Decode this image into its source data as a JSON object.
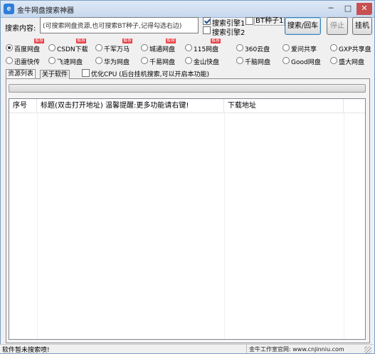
{
  "window": {
    "title": "金牛网盘搜索神器",
    "controls": {
      "minimize": "─",
      "maximize": "□",
      "close": "✕"
    }
  },
  "search": {
    "label": "搜索内容:",
    "value": "(可搜索网盘资源,也可搜索BT种子,记得勾选右边)",
    "engine1_label": "搜索引擎1",
    "engine1_checked": true,
    "engine2_label": "搜索引擎2",
    "engine2_checked": false,
    "bt_label": "BT种子1",
    "bt_checked": false,
    "search_button": "搜索/回车",
    "stop_button": "停止",
    "hang_button": "挂机"
  },
  "disks_row1": [
    {
      "label": "百度网盘",
      "selected": true,
      "badge": "推荐"
    },
    {
      "label": "CSDN下载",
      "selected": false,
      "badge": "推荐"
    },
    {
      "label": "千军万马",
      "selected": false,
      "badge": "推荐"
    },
    {
      "label": "城通网盘",
      "selected": false,
      "badge": "推荐"
    },
    {
      "label": "115网盘",
      "selected": false,
      "badge": "推荐"
    },
    {
      "label": "360云盘",
      "selected": false,
      "badge": ""
    },
    {
      "label": "爱问共享",
      "selected": false,
      "badge": ""
    },
    {
      "label": "GXP共享盘",
      "selected": false,
      "badge": ""
    }
  ],
  "disks_row2": [
    {
      "label": "迅雷快传",
      "selected": false
    },
    {
      "label": "飞速网盘",
      "selected": false
    },
    {
      "label": "华为网盘",
      "selected": false
    },
    {
      "label": "千易网盘",
      "selected": false
    },
    {
      "label": "金山快盘",
      "selected": false
    },
    {
      "label": "千脑网盘",
      "selected": false
    },
    {
      "label": "Good网盘",
      "selected": false
    },
    {
      "label": "盛大网盘",
      "selected": false
    }
  ],
  "tabs": {
    "results": "资源列表",
    "about": "关于软件"
  },
  "options": {
    "optimize_cpu": "优化CPU (后台挂机搜索,可以开启本功能)",
    "optimize_cpu_checked": false
  },
  "progress": {
    "fraction": 0
  },
  "table": {
    "headers": [
      "序号",
      "标题(双击打开地址) 温馨提醒:更多功能请右键!",
      "下载地址",
      ""
    ],
    "rows": []
  },
  "status": {
    "left": "软件暂未搜索喷!",
    "right": "金牛工作室官网: www.cnjinniu.com"
  }
}
